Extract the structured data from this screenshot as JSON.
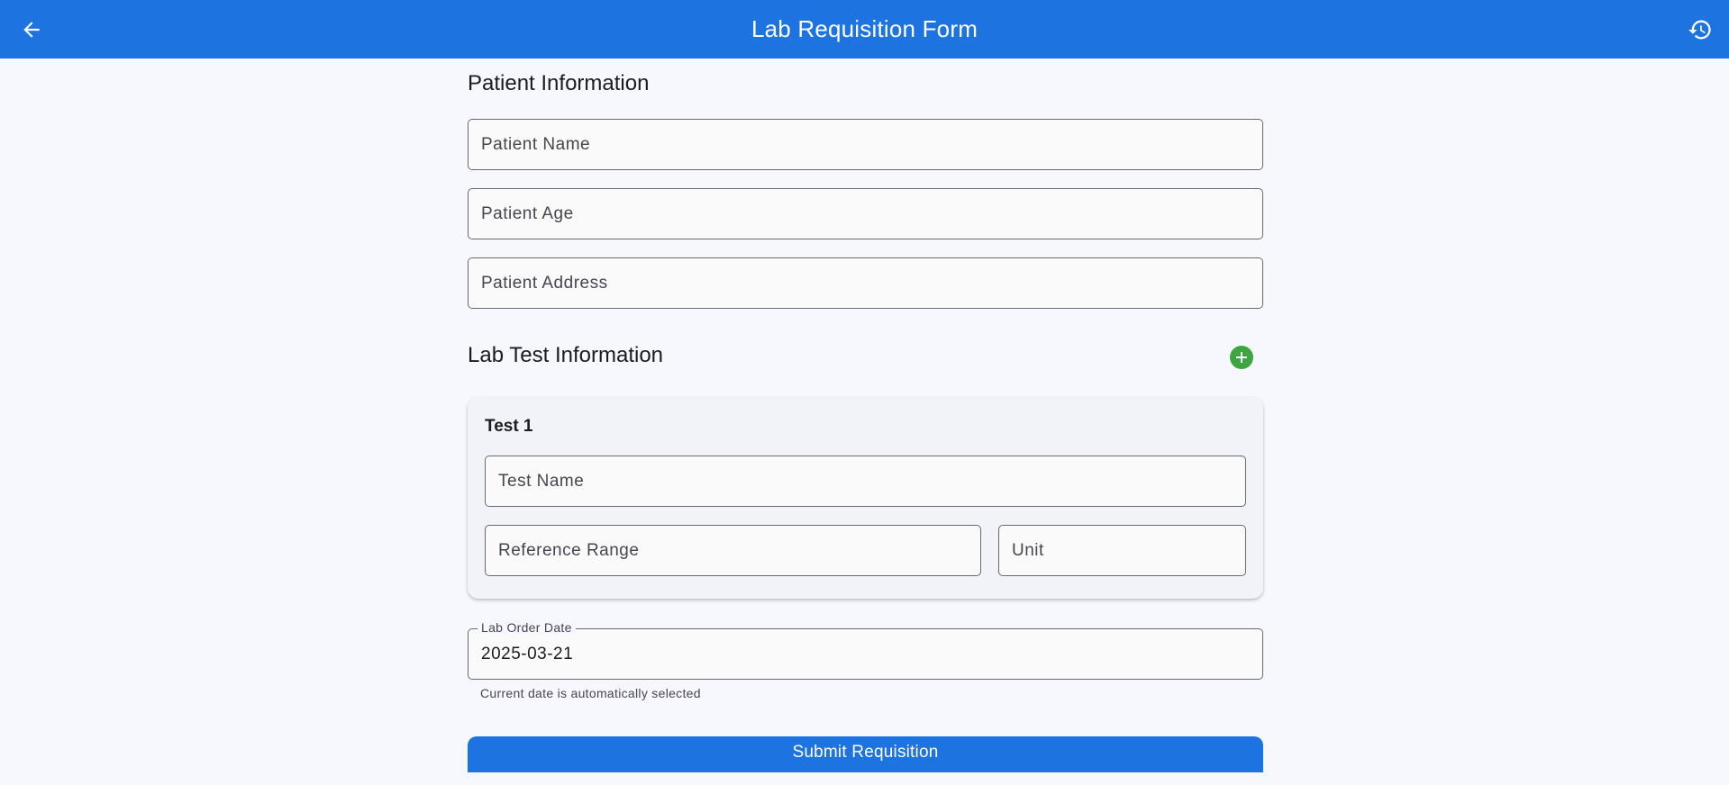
{
  "appbar": {
    "title": "Lab Requisition Form",
    "back_icon": "arrow-back-icon",
    "history_icon": "history-icon",
    "color": "#1d73e0"
  },
  "patient": {
    "section_title": "Patient Information",
    "name_placeholder": "Patient Name",
    "age_placeholder": "Patient Age",
    "address_placeholder": "Patient Address"
  },
  "lab_tests": {
    "section_title": "Lab Test Information",
    "add_icon": "add-circle-icon",
    "add_color": "#3ea640",
    "tests": [
      {
        "title": "Test 1",
        "test_name_placeholder": "Test Name",
        "reference_range_placeholder": "Reference Range",
        "unit_placeholder": "Unit"
      }
    ]
  },
  "order_date": {
    "label": "Lab Order Date",
    "value": "2025-03-21",
    "helper": "Current date is automatically selected"
  },
  "submit": {
    "label": "Submit Requisition"
  }
}
